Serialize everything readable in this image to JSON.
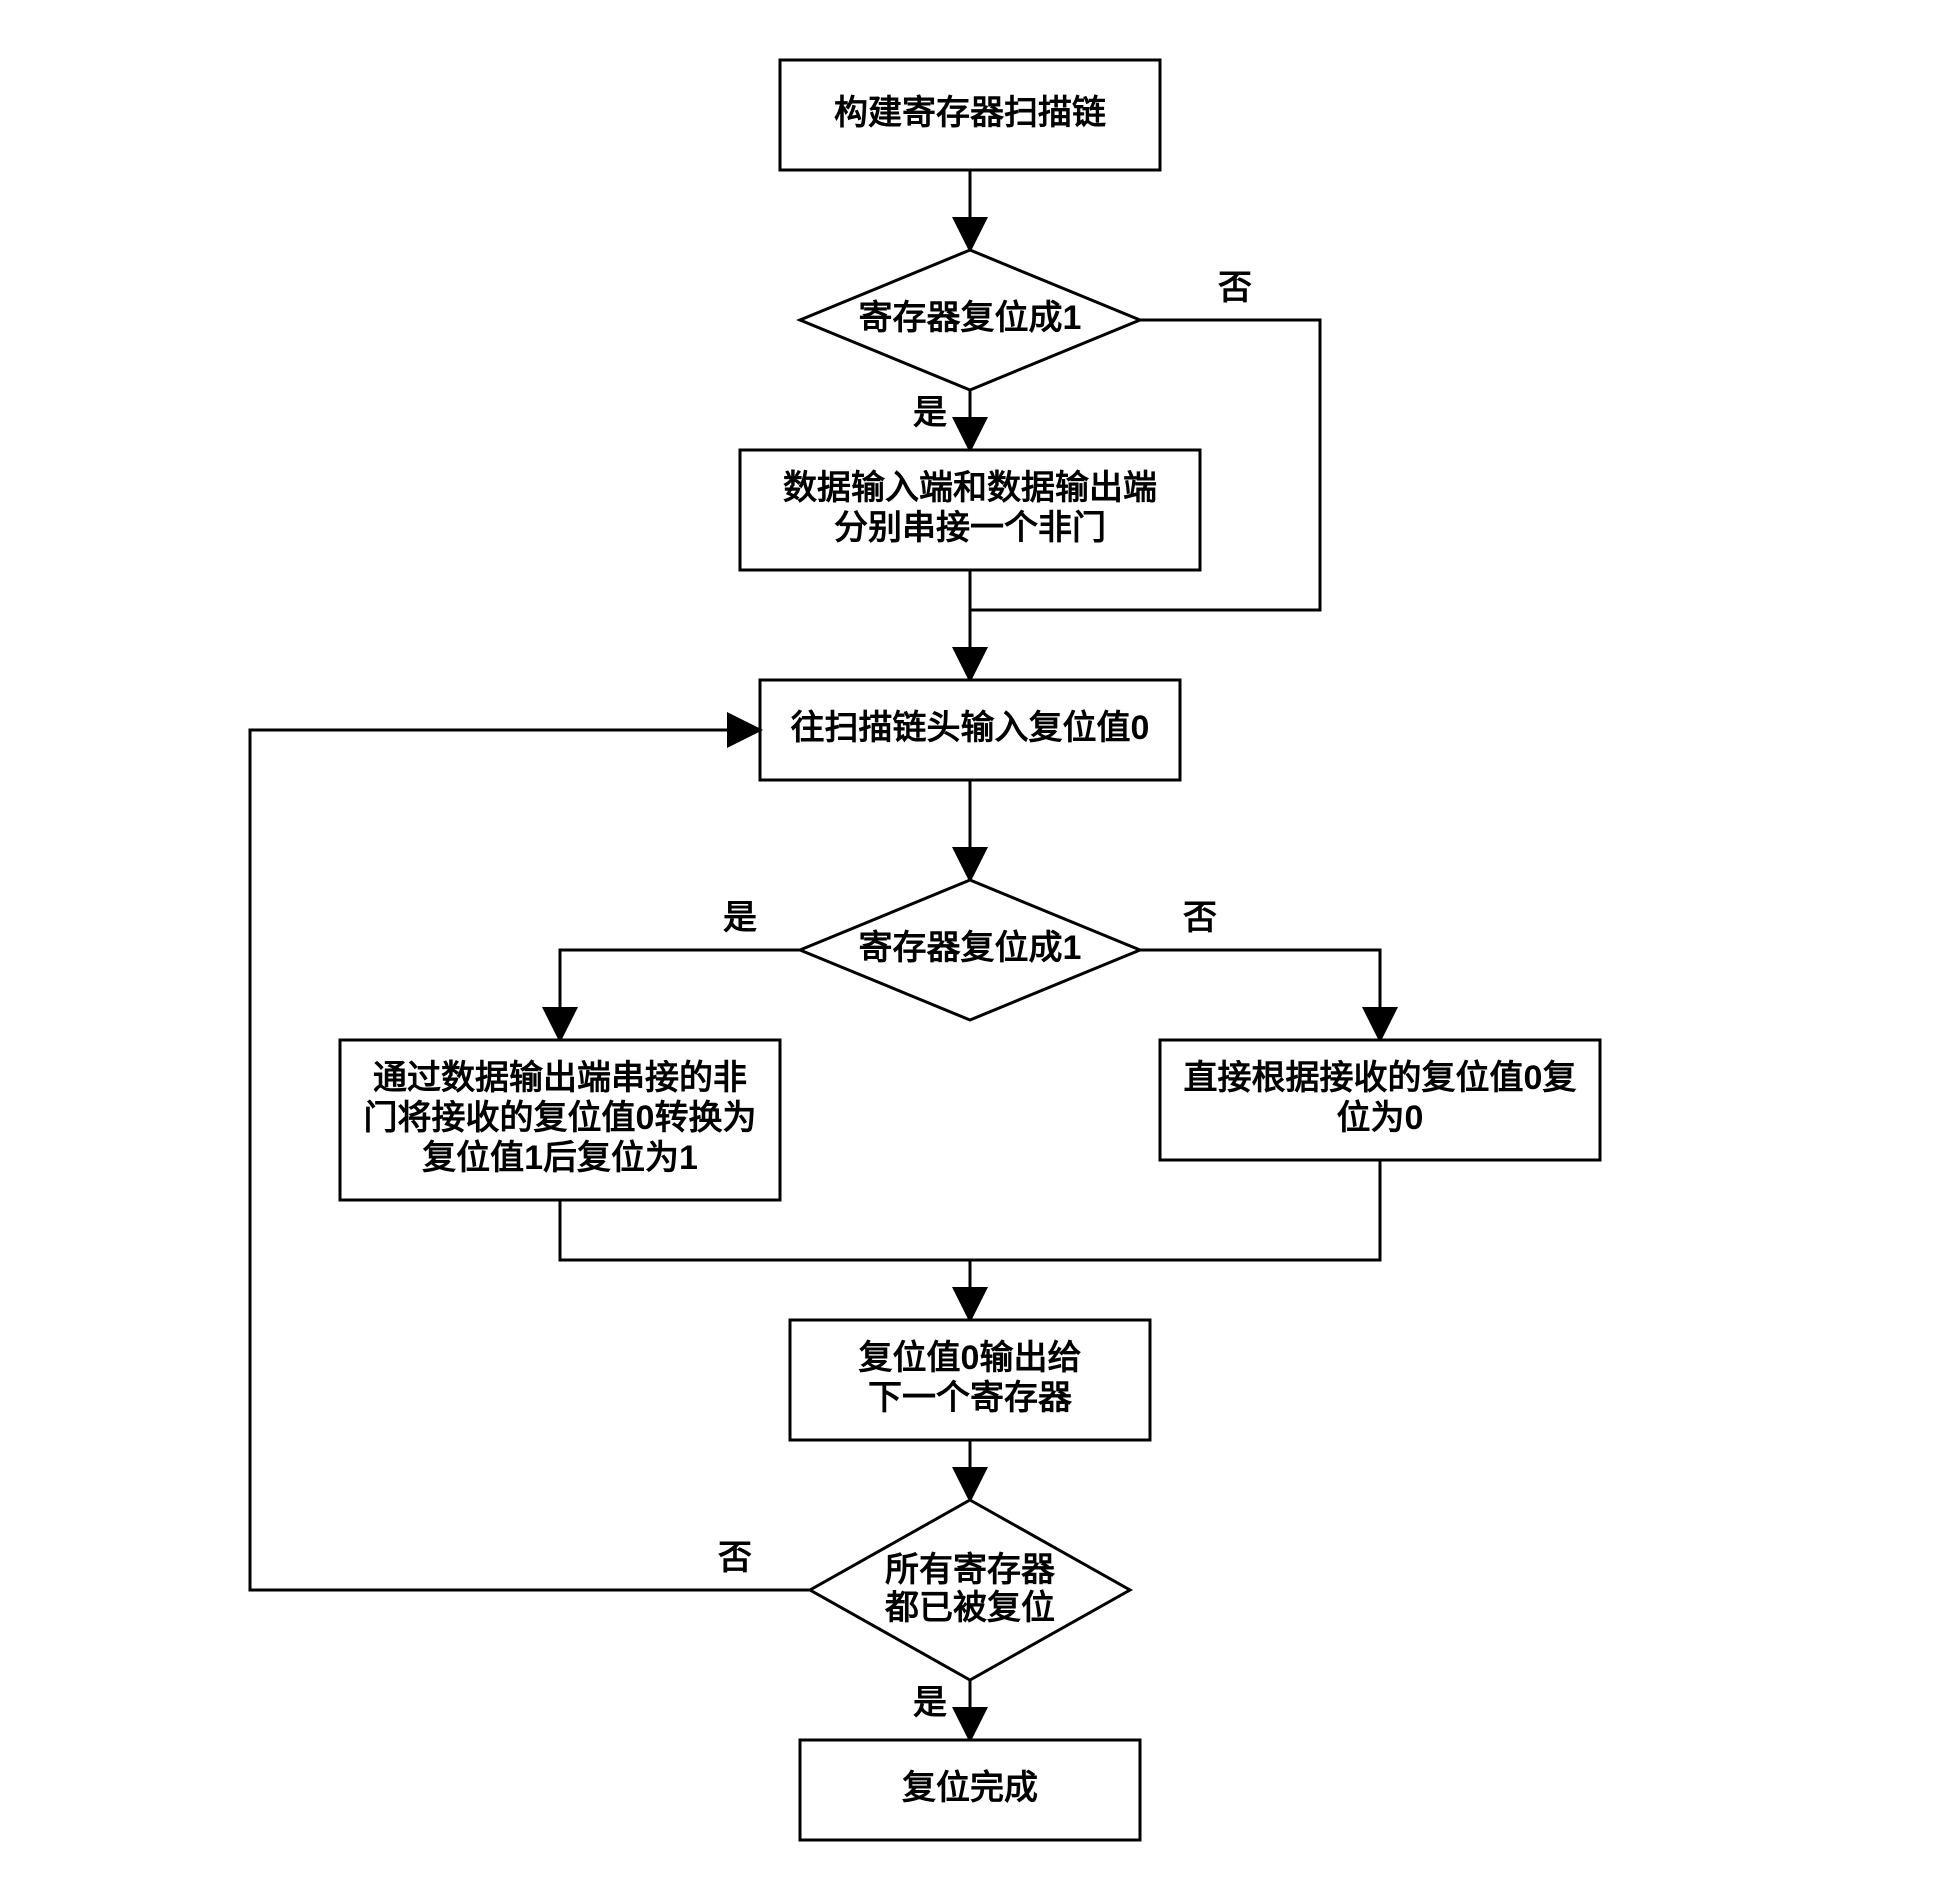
{
  "nodes": {
    "n1": "构建寄存器扫描链",
    "d1": "寄存器复位成1",
    "n2_l1": "数据输入端和数据输出端",
    "n2_l2": "分别串接一个非门",
    "n3": "往扫描链头输入复位值0",
    "d2": "寄存器复位成1",
    "n4_l1": "通过数据输出端串接的非",
    "n4_l2": "门将接收的复位值0转换为",
    "n4_l3": "复位值1后复位为1",
    "n5_l1": "直接根据接收的复位值0复",
    "n5_l2": "位为0",
    "n6_l1": "复位值0输出给",
    "n6_l2": "下一个寄存器",
    "d3_l1": "所有寄存器",
    "d3_l2": "都已被复位",
    "n7": "复位完成"
  },
  "labels": {
    "yes": "是",
    "no": "否"
  }
}
